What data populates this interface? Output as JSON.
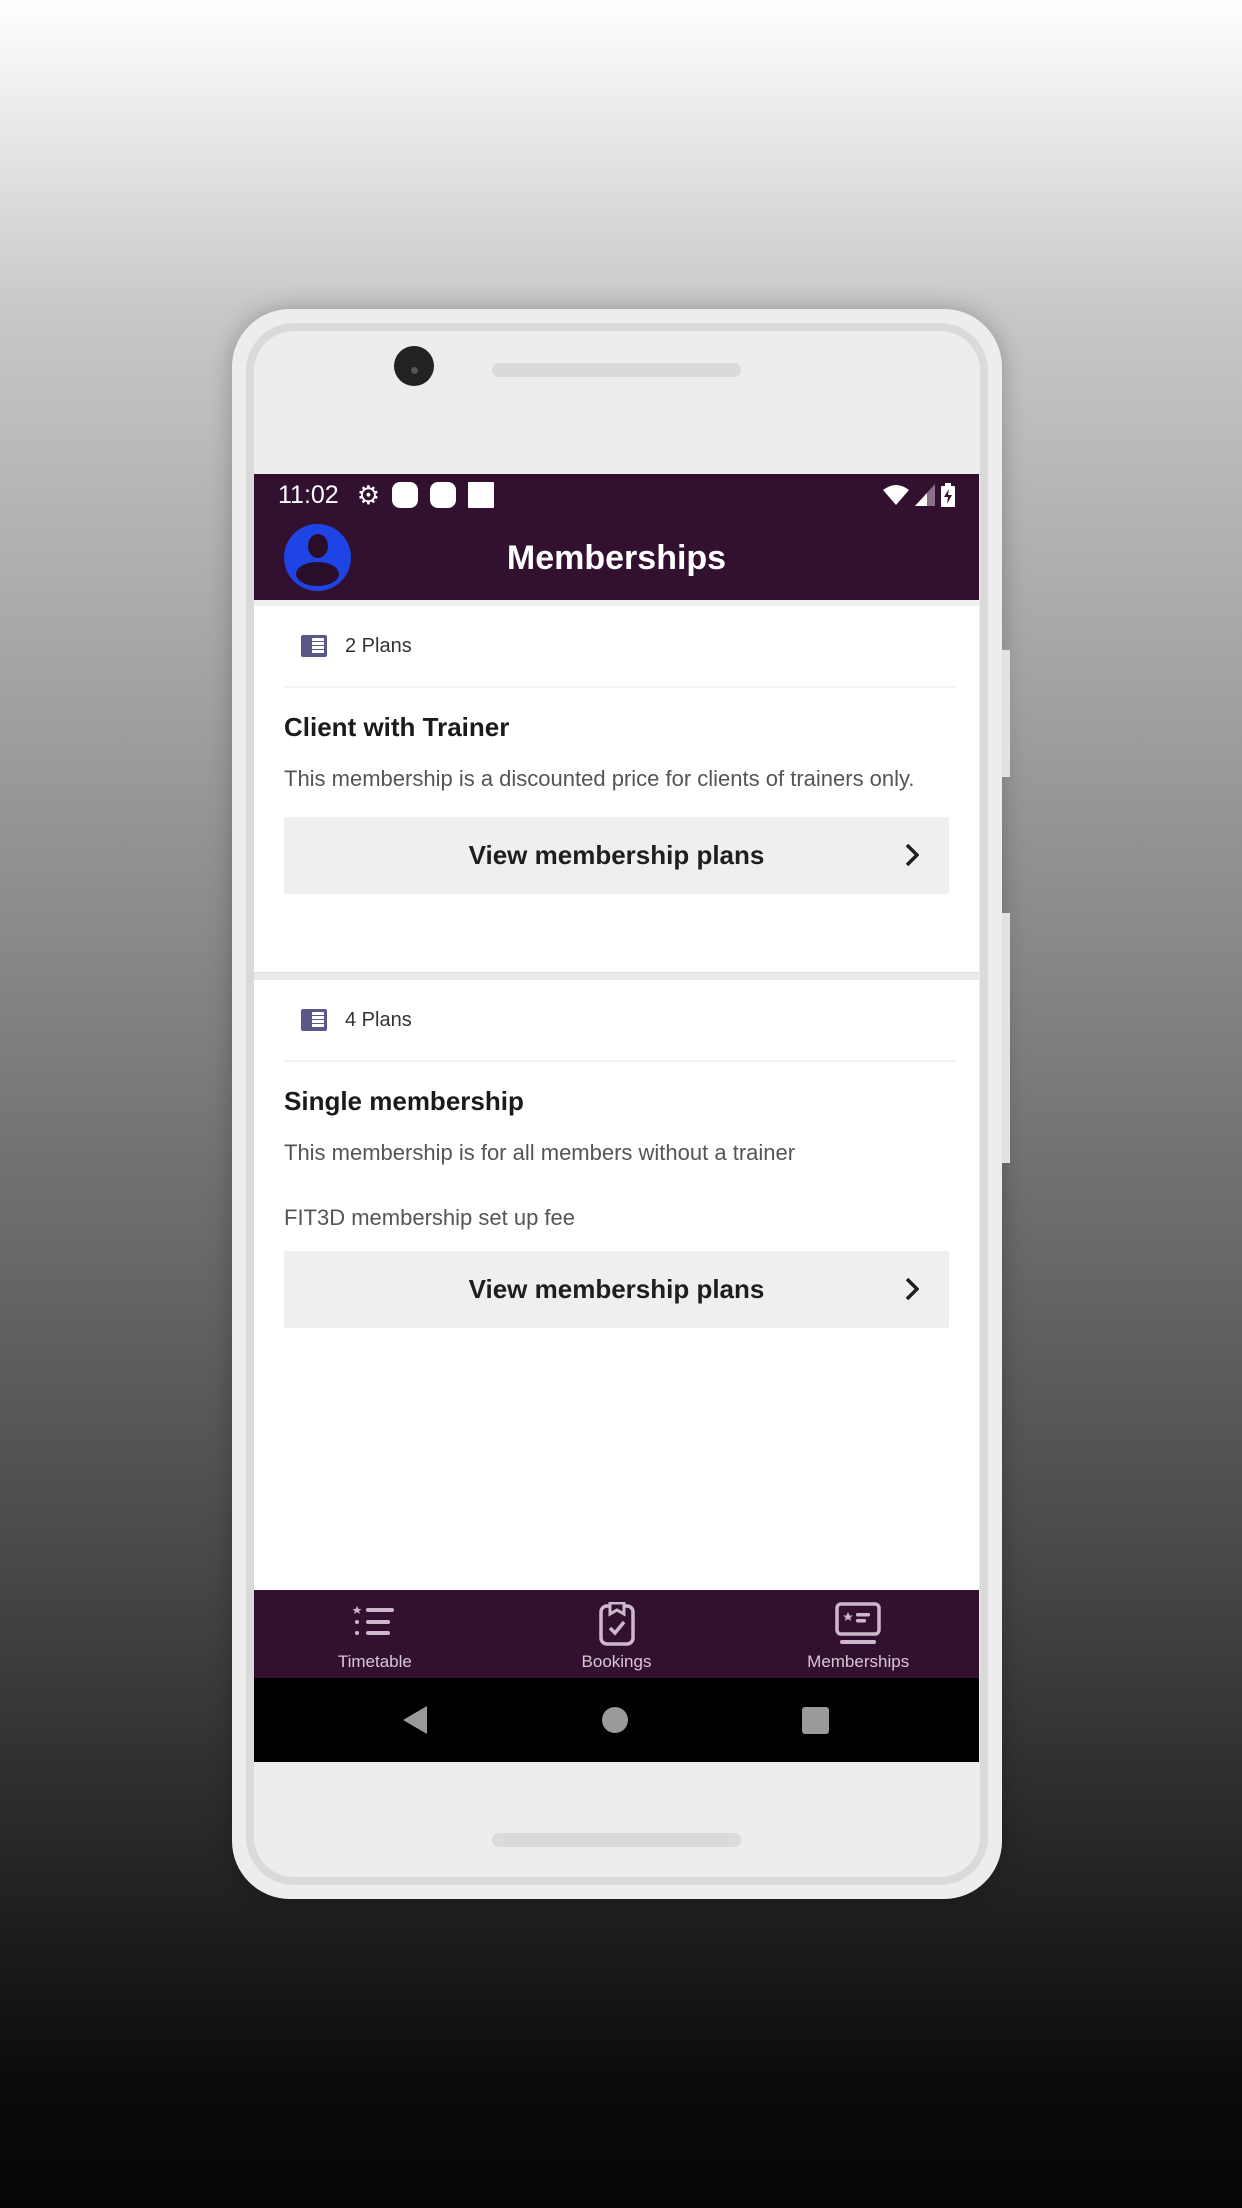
{
  "status_bar": {
    "time": "11:02",
    "left_icons": [
      "gear-icon",
      "notification-icon",
      "notification-icon",
      "notification-square-icon"
    ],
    "right_icons": [
      "wifi-icon",
      "signal-icon",
      "battery-charging-icon"
    ]
  },
  "app_bar": {
    "title": "Memberships",
    "avatar_icon": "account-circle-icon"
  },
  "memberships": [
    {
      "plans_count": "2 Plans",
      "title": "Client with Trainer",
      "description": "This membership is a discounted price for clients of trainers only.",
      "extra": "",
      "button_label": "View membership plans"
    },
    {
      "plans_count": "4 Plans",
      "title": "Single membership",
      "description": "This membership is for all members without a trainer",
      "extra": "FIT3D membership  set up fee",
      "button_label": "View membership plans"
    }
  ],
  "bottom_nav": {
    "items": [
      {
        "label": "Timetable",
        "icon": "timetable-list-icon"
      },
      {
        "label": "Bookings",
        "icon": "clipboard-check-icon"
      },
      {
        "label": "Memberships",
        "icon": "membership-card-icon"
      }
    ]
  },
  "colors": {
    "brand": "#32102f",
    "avatar": "#1f44e6",
    "plans_icon": "#5a5888",
    "button_bg": "#f0eeee"
  }
}
